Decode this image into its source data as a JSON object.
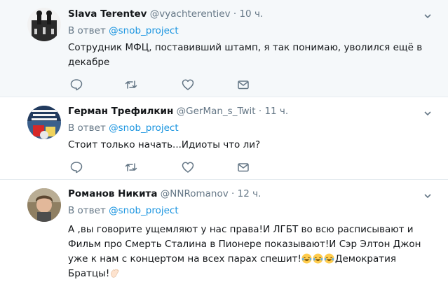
{
  "tweets": [
    {
      "name": "Slava Terentev",
      "handle": "@vyachterentiev",
      "dot": "·",
      "time": "10 ч.",
      "reply_prefix": "В ответ",
      "reply_to": "@snob_project",
      "text": "Сотрудник МФЦ, поставивший штамп, я так понимаю, уволился ещё в декабре"
    },
    {
      "name": "Герман Трефилкин",
      "handle": "@GerMan_s_Twit",
      "dot": "·",
      "time": "11 ч.",
      "reply_prefix": "В ответ",
      "reply_to": "@snob_project",
      "text": "Стоит только начать...Идиоты что ли?"
    },
    {
      "name": "Романов Никита",
      "handle": "@NNRomanov",
      "dot": "·",
      "time": "12 ч.",
      "reply_prefix": "В ответ",
      "reply_to": "@snob_project",
      "text_a": "А ,вы говорите ущемляют у нас права!И ЛГБТ во всю расписывают и Фильм про Смерть Сталина в Пионере показывают!И Сэр Элтон Джон уже к нам с концертом на всех парах спешит!",
      "text_b": "Демократия Братцы!"
    }
  ],
  "icons": {
    "reply": "reply-icon",
    "retweet": "retweet-icon",
    "like": "heart-icon",
    "dm": "envelope-icon",
    "caret": "chevron-down-icon"
  },
  "colors": {
    "link": "#1b95e0",
    "muted": "#657786",
    "divider": "#e6ecf0"
  }
}
